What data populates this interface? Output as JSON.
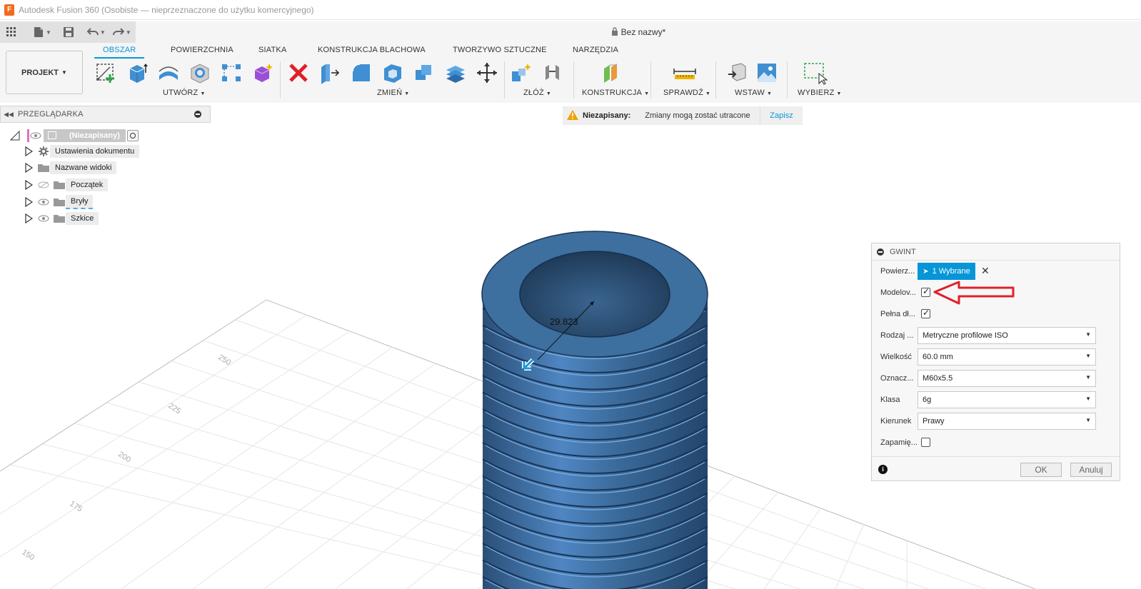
{
  "window": {
    "title": "Autodesk Fusion 360 (Osobiste — nieprzeznaczone do użytku komercyjnego)",
    "app_letter": "F"
  },
  "document": {
    "title": "Bez nazwy*"
  },
  "ribbon": {
    "project_label": "PROJEKT",
    "tabs": [
      "OBSZAR",
      "POWIERZCHNIA",
      "SIATKA",
      "KONSTRUKCJA BLACHOWA",
      "TWORZYWO SZTUCZNE",
      "NARZĘDZIA"
    ],
    "groups": [
      "UTWÓRZ",
      "ZMIEŃ",
      "ZŁÓŻ",
      "KONSTRUKCJA",
      "SPRAWDŹ",
      "WSTAW",
      "WYBIERZ"
    ]
  },
  "browser": {
    "title": "PRZEGLĄDARKA",
    "root": "(Niezapisany)",
    "items": [
      "Ustawienia dokumentu",
      "Nazwane widoki",
      "Początek",
      "Bryły",
      "Szkice"
    ]
  },
  "warning": {
    "title": "Niezapisany:",
    "message": "Zmiany mogą zostać utracone",
    "action": "Zapisz"
  },
  "viewport": {
    "dimension": "29.823",
    "grid_labels": [
      "250",
      "225",
      "200",
      "175",
      "150"
    ],
    "model_color": "#3b6a9a"
  },
  "dialog": {
    "title": "GWINT",
    "rows": [
      {
        "label": "Powierz...",
        "kind": "selection",
        "value": "1 Wybrane"
      },
      {
        "label": "Modelov...",
        "kind": "checkbox",
        "checked": true
      },
      {
        "label": "Pełna dł...",
        "kind": "checkbox",
        "checked": true
      },
      {
        "label": "Rodzaj ...",
        "kind": "select",
        "value": "Metryczne profilowe ISO"
      },
      {
        "label": "Wielkość",
        "kind": "select",
        "value": "60.0 mm"
      },
      {
        "label": "Oznacz...",
        "kind": "select",
        "value": "M60x5.5"
      },
      {
        "label": "Klasa",
        "kind": "select",
        "value": "6g"
      },
      {
        "label": "Kierunek",
        "kind": "select",
        "value": "Prawy"
      },
      {
        "label": "Zapamię...",
        "kind": "checkbox",
        "checked": false
      }
    ],
    "ok": "OK",
    "cancel": "Anuluj"
  },
  "colors": {
    "accent": "#0696d7",
    "annotation_red": "#e0202a",
    "panel_bg": "#f5f5f5"
  }
}
